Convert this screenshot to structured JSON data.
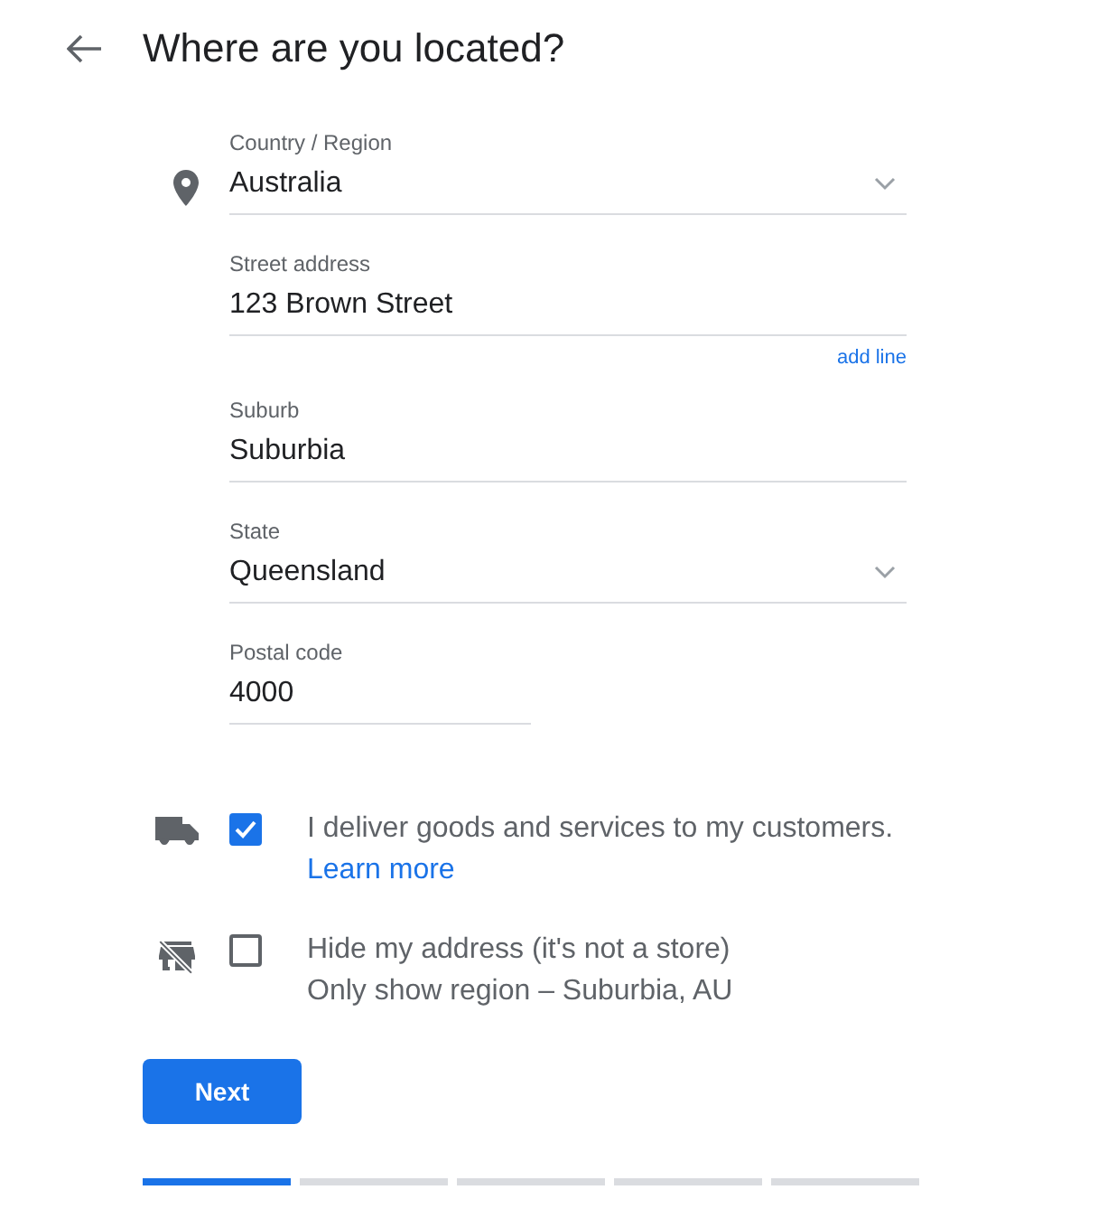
{
  "title": "Where are you located?",
  "fields": [
    {
      "kind": "select",
      "label": "Country / Region",
      "value": "Australia"
    },
    {
      "kind": "text",
      "label": "Street address",
      "value": "123 Brown Street",
      "link": "add line"
    },
    {
      "kind": "text",
      "label": "Suburb",
      "value": "Suburbia"
    },
    {
      "kind": "select",
      "label": "State",
      "value": "Queensland"
    },
    {
      "kind": "short",
      "label": "Postal code",
      "value": "4000"
    }
  ],
  "options": [
    {
      "checked": true,
      "text": "I deliver goods and services to my customers.",
      "link": "Learn more"
    },
    {
      "checked": false,
      "text": "Hide my address (it's not a store)",
      "note": "Only show region – Suburbia, AU"
    }
  ],
  "button": "Next",
  "steps": [
    {
      "done": true
    },
    {
      "done": false
    },
    {
      "done": false
    },
    {
      "done": false
    },
    {
      "done": false
    }
  ]
}
